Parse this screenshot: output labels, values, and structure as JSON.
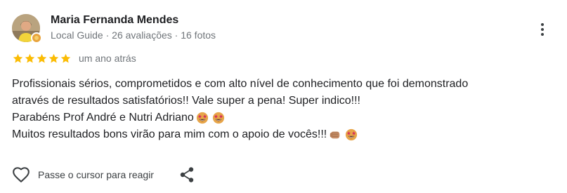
{
  "reviewer": {
    "name": "Maria Fernanda Mendes",
    "meta": "Local Guide · 26 avaliações · 16 fotos"
  },
  "review": {
    "rating": 5,
    "max_rating": 5,
    "date": "um ano atrás",
    "lines": [
      "Profissionais sérios, comprometidos e com alto nível de conhecimento que foi demonstrado",
      "através de resultados satisfatórios!! Vale super a pena! Super indico!!!",
      "Parabéns Prof André e Nutri Adriano",
      "Muitos resultados bons virão para mim com o apoio de vocês!!!"
    ],
    "emojis": {
      "line3": [
        "star-struck-emoji",
        "star-struck-emoji"
      ],
      "line4": [
        "fist-bump-emoji",
        "star-struck-emoji"
      ]
    }
  },
  "actions": {
    "react_hint": "Passe o cursor para reagir",
    "like_icon": "heart-outline-icon",
    "share_icon": "share-icon",
    "more_icon": "more-vert-icon"
  },
  "colors": {
    "star": "#fbbc04",
    "meta_text": "#70757a",
    "body_text": "#202124",
    "badge": "#e8a33d"
  }
}
